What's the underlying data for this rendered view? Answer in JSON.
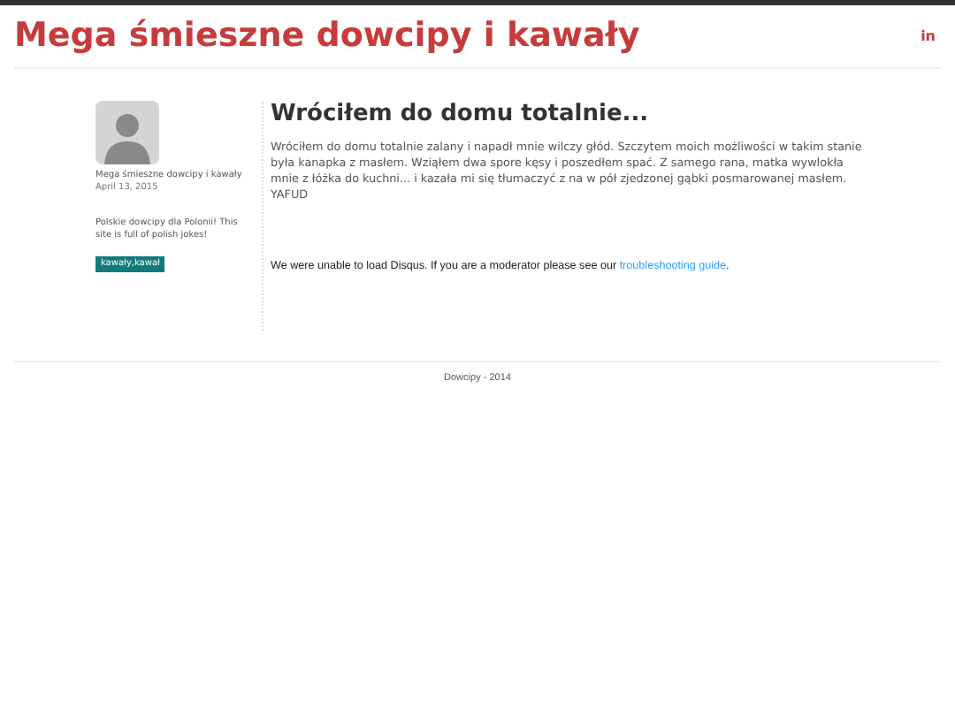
{
  "header": {
    "title": "Mega śmieszne dowcipy i kawały",
    "social_link": "in"
  },
  "sidebar": {
    "author": "Mega śmieszne dowcipy i kawały",
    "date": "April 13, 2015",
    "description": "Polskie dowcipy dla Polonii! This site is full of polish jokes!",
    "tags": [
      "kawały,kawał"
    ]
  },
  "post": {
    "title": "Wróciłem do domu totalnie...",
    "body": "Wróciłem do domu totalnie zalany i napadł mnie wilczy głód. Szczytem moich możliwości w takim stanie była kanapka z masłem. Wziąłem dwa spore kęsy i poszedłem spać. Z samego rana, matka wywlokła mnie z łóżka do kuchni... i kazała mi się tłumaczyć z na w pół zjedzonej gąbki posmarowanej masłem. YAFUD"
  },
  "comments": {
    "message": "We were unable to load Disqus. If you are a moderator please see our ",
    "link": "troubleshooting guide",
    "end": "."
  },
  "footer": {
    "text": "Dowcipy - 2014"
  }
}
